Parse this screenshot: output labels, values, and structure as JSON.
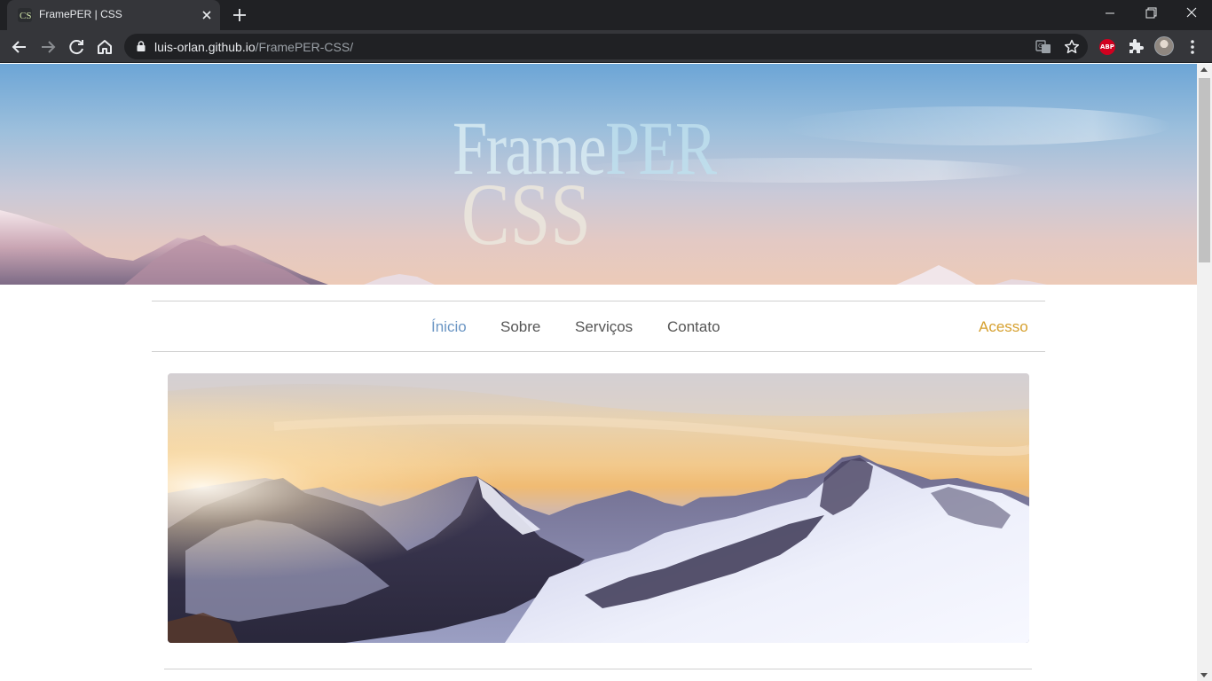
{
  "browser": {
    "tab_title": "FramePER | CSS",
    "url_host": "luis-orlan.github.io",
    "url_path": "/FramePER-CSS/",
    "extension_abp_label": "ABP"
  },
  "hero": {
    "logo_line1_a": "Frame",
    "logo_line1_b": "PER",
    "logo_line2": "CSS"
  },
  "nav": {
    "items": [
      {
        "label": "Ínicio",
        "active": true
      },
      {
        "label": "Sobre",
        "active": false
      },
      {
        "label": "Serviços",
        "active": false
      },
      {
        "label": "Contato",
        "active": false
      }
    ],
    "access_label": "Acesso"
  },
  "colors": {
    "nav_active": "#6b96c4",
    "nav_access": "#d6a02e",
    "nav_text": "#555555"
  },
  "icons": {
    "back": "arrow-left-icon",
    "forward": "arrow-right-icon",
    "reload": "reload-icon",
    "home": "home-icon",
    "lock": "lock-icon",
    "translate": "translate-icon",
    "bookmark": "star-icon",
    "extensions": "puzzle-icon",
    "menu": "kebab-menu-icon"
  }
}
